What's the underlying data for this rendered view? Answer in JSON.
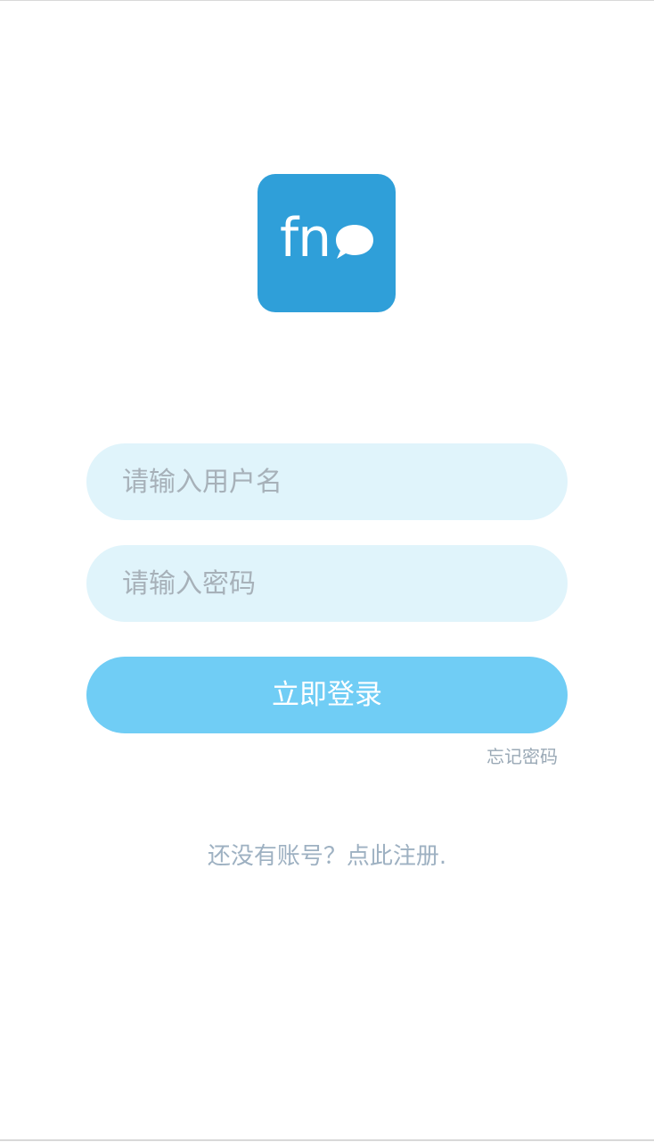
{
  "logo": {
    "text": "fn",
    "icon": "chat-bubble-icon",
    "background_color": "#2f9fd9"
  },
  "form": {
    "username_placeholder": "请输入用户名",
    "username_value": "",
    "password_placeholder": "请输入密码",
    "password_value": "",
    "field_background_color": "#e0f4fb"
  },
  "actions": {
    "login_label": "立即登录",
    "login_color": "#70cdf5",
    "forgot_password_label": "忘记密码",
    "register_label": "还没有账号？点此注册."
  }
}
